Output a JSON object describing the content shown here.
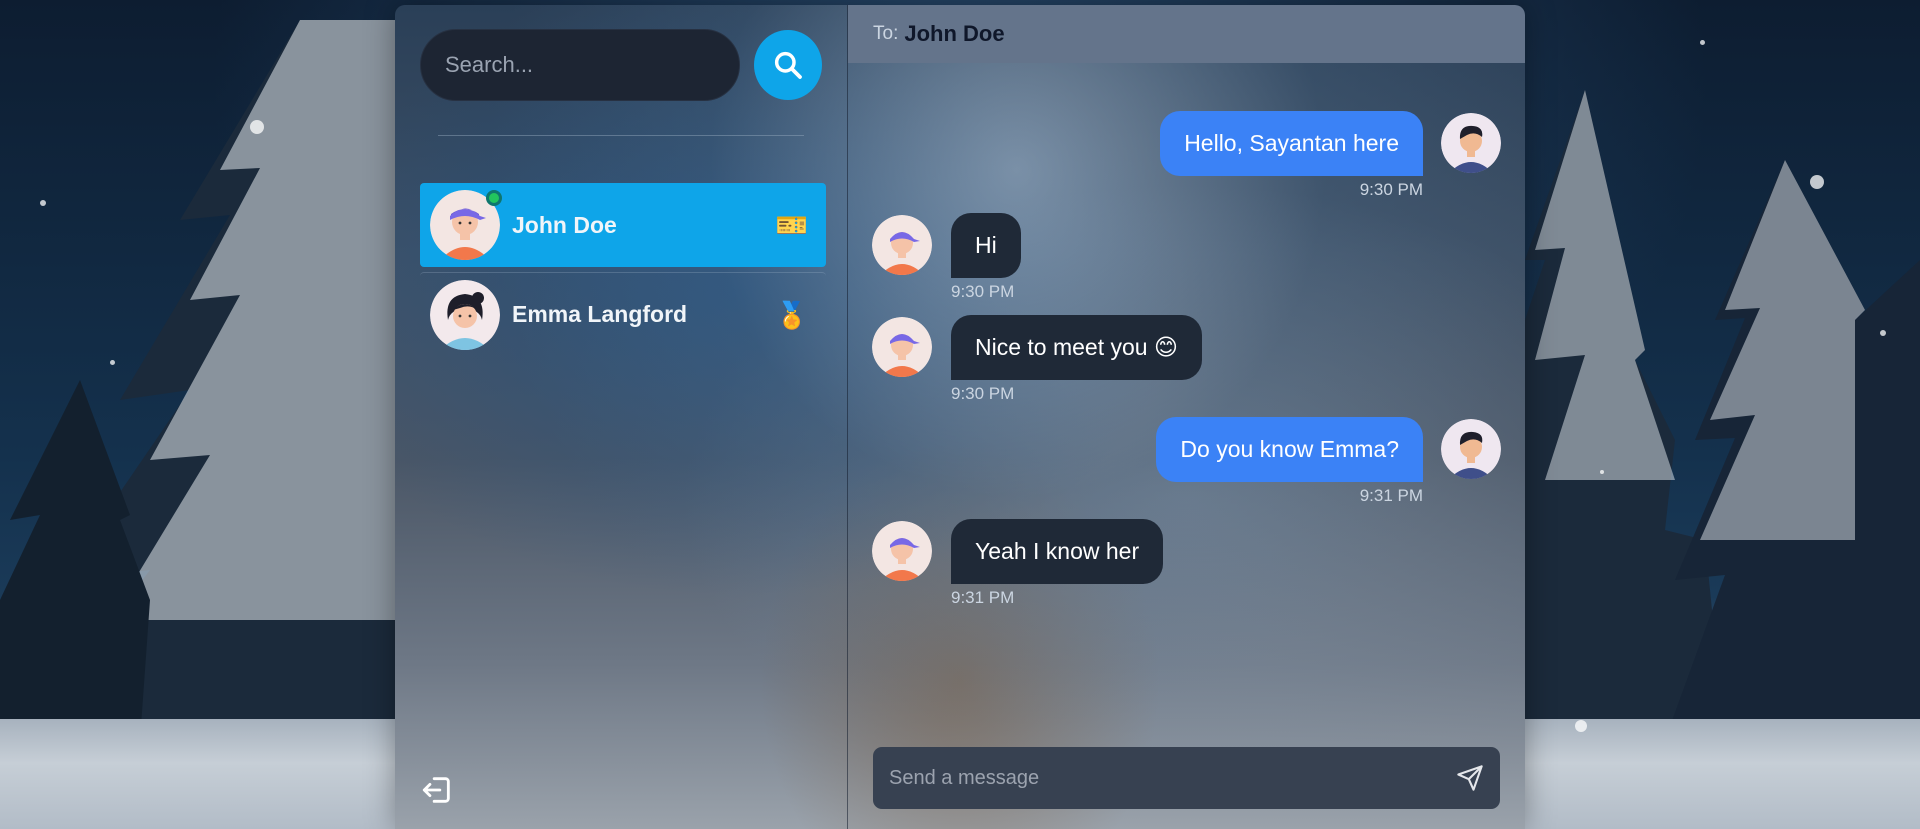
{
  "search": {
    "placeholder": "Search..."
  },
  "conversations": [
    {
      "name": "John Doe",
      "emoji": "🎫",
      "active": true,
      "online": true
    },
    {
      "name": "Emma Langford",
      "emoji": "🏅",
      "active": false,
      "online": false
    }
  ],
  "chat": {
    "to_label": "To:",
    "to_name": "John Doe",
    "messages": [
      {
        "from": "me",
        "text": "Hello, Sayantan here",
        "time": "9:30 PM"
      },
      {
        "from": "them",
        "text": "Hi",
        "time": "9:30 PM"
      },
      {
        "from": "them",
        "text": "Nice to meet you 😊",
        "time": "9:30 PM"
      },
      {
        "from": "me",
        "text": "Do you know Emma?",
        "time": "9:31 PM"
      },
      {
        "from": "them",
        "text": "Yeah I know her",
        "time": "9:31 PM"
      }
    ],
    "composer_placeholder": "Send a message"
  },
  "colors": {
    "accent": "#0ea5e9",
    "outgoing_bubble": "#3b82f6",
    "incoming_bubble": "#1f2937",
    "header": "#64748b"
  },
  "icons": {
    "search": "search-icon",
    "logout": "logout-icon",
    "send": "send-icon"
  }
}
